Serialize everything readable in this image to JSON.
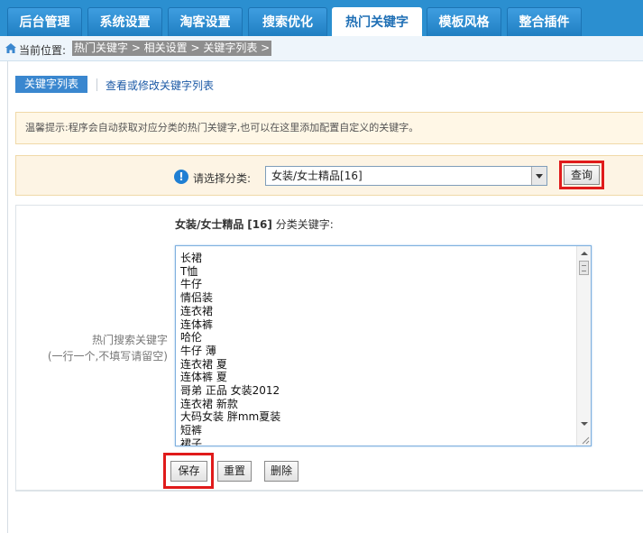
{
  "nav": {
    "tabs": [
      {
        "label": "后台管理"
      },
      {
        "label": "系统设置"
      },
      {
        "label": "淘客设置"
      },
      {
        "label": "搜索优化"
      },
      {
        "label": "热门关键字"
      },
      {
        "label": "模板风格"
      },
      {
        "label": "整合插件"
      }
    ],
    "active_index": 4
  },
  "breadcrumb": {
    "prefix": "当前位置:",
    "path": "热门关键字 > 相关设置 > 关键字列表 >"
  },
  "subtabs": {
    "active": "关键字列表",
    "link": "查看或修改关键字列表"
  },
  "tip": {
    "text": "温馨提示:程序会自动获取对应分类的热门关键字,也可以在这里添加配置自定义的关键字。"
  },
  "filter": {
    "label": "请选择分类:",
    "selected": "女装/女士精品[16]",
    "query_button": "查询"
  },
  "form": {
    "category_name": "女装/女士精品",
    "category_id": "[16]",
    "category_suffix": "分类关键字:",
    "field_label_line1": "热门搜索关键字",
    "field_label_line2": "(一行一个,不填写请留空)",
    "keywords": [
      "长裙",
      "T恤",
      "牛仔",
      "情侣装",
      "连衣裙",
      "连体裤",
      "哈伦",
      "牛仔 薄",
      "连衣裙 夏",
      "连体裤 夏",
      "哥弟 正品 女装2012",
      "连衣裙 新款",
      "大码女装 胖mm夏装",
      "短裤",
      "裙子"
    ],
    "buttons": {
      "save": "保存",
      "reset": "重置",
      "delete": "删除"
    }
  },
  "colors": {
    "nav_bg": "#2b8fd0",
    "highlight": "#e01b1b",
    "tip_bg": "#fff7e6"
  }
}
